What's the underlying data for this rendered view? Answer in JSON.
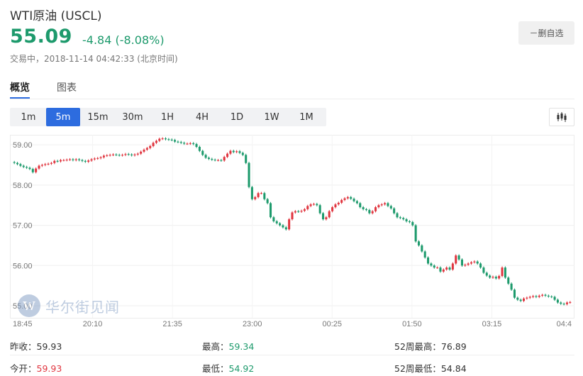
{
  "header": {
    "title": "WTI原油 (USCL)",
    "price": "55.09",
    "change": "-4.84 (-8.08%)",
    "status": "交易中，2018-11-14 04:42:33 (北京时间)",
    "remove_watchlist": "－删自选"
  },
  "tabs": [
    "概览",
    "图表"
  ],
  "intervals": [
    "1m",
    "5m",
    "15m",
    "30m",
    "1H",
    "4H",
    "1D",
    "1W",
    "1M"
  ],
  "selected_interval": "5m",
  "watermark": "华尔街见闻",
  "colors": {
    "up": "#e0353f",
    "down": "#1d9a6c",
    "accent": "#2d6cdf"
  },
  "chart_data": {
    "type": "candlestick",
    "x_ticks": [
      "18:45",
      "20:10",
      "21:35",
      "23:00",
      "00:25",
      "01:50",
      "03:15",
      "04:4"
    ],
    "y_ticks": [
      "59.00",
      "58.00",
      "57.00",
      "56.00",
      "55.00"
    ],
    "ylim": [
      54.7,
      59.25
    ],
    "grid": true,
    "closes": [
      58.55,
      58.52,
      58.48,
      58.45,
      58.43,
      58.4,
      58.32,
      58.41,
      58.48,
      58.5,
      58.52,
      58.53,
      58.55,
      58.6,
      58.59,
      58.62,
      58.62,
      58.63,
      58.64,
      58.62,
      58.64,
      58.62,
      58.6,
      58.58,
      58.61,
      58.64,
      58.66,
      58.67,
      58.69,
      58.73,
      58.74,
      58.75,
      58.76,
      58.75,
      58.74,
      58.75,
      58.77,
      58.76,
      58.74,
      58.76,
      58.78,
      58.83,
      58.88,
      58.92,
      58.97,
      59.05,
      59.1,
      59.15,
      59.16,
      59.14,
      59.13,
      59.12,
      59.08,
      59.07,
      59.05,
      59.03,
      59.03,
      59.04,
      59.02,
      58.95,
      58.85,
      58.75,
      58.68,
      58.65,
      58.63,
      58.62,
      58.62,
      58.61,
      58.7,
      58.78,
      58.85,
      58.82,
      58.84,
      58.8,
      58.75,
      58.55,
      57.95,
      57.65,
      57.7,
      57.8,
      57.8,
      57.65,
      57.55,
      57.2,
      57.1,
      57.05,
      57.0,
      56.95,
      56.9,
      57.15,
      57.32,
      57.35,
      57.34,
      57.36,
      57.4,
      57.48,
      57.52,
      57.53,
      57.5,
      57.3,
      57.15,
      57.2,
      57.35,
      57.45,
      57.52,
      57.56,
      57.63,
      57.67,
      57.7,
      57.66,
      57.6,
      57.55,
      57.45,
      57.4,
      57.38,
      57.3,
      57.35,
      57.45,
      57.5,
      57.52,
      57.55,
      57.48,
      57.42,
      57.3,
      57.2,
      57.18,
      57.15,
      57.1,
      57.08,
      57.0,
      56.6,
      56.5,
      56.35,
      56.2,
      56.05,
      56.0,
      55.95,
      55.95,
      55.85,
      55.9,
      55.95,
      55.9,
      56.05,
      56.25,
      56.15,
      56.0,
      56.02,
      56.05,
      56.08,
      56.1,
      56.05,
      55.95,
      55.82,
      55.75,
      55.7,
      55.72,
      55.68,
      55.74,
      55.95,
      55.7,
      55.55,
      55.4,
      55.2,
      55.15,
      55.12,
      55.18,
      55.2,
      55.22,
      55.24,
      55.22,
      55.25,
      55.27,
      55.25,
      55.23,
      55.22,
      55.15,
      55.08,
      55.05,
      55.04,
      55.08,
      55.09
    ]
  },
  "stats": {
    "prev_close_label": "昨收：",
    "prev_close": "59.93",
    "high_label": "最高：",
    "high": "59.34",
    "high52_label": "52周最高：",
    "high52": "76.89",
    "open_label": "今开：",
    "open": "59.93",
    "low_label": "最低：",
    "low": "54.92",
    "low52_label": "52周最低：",
    "low52": "54.84"
  }
}
